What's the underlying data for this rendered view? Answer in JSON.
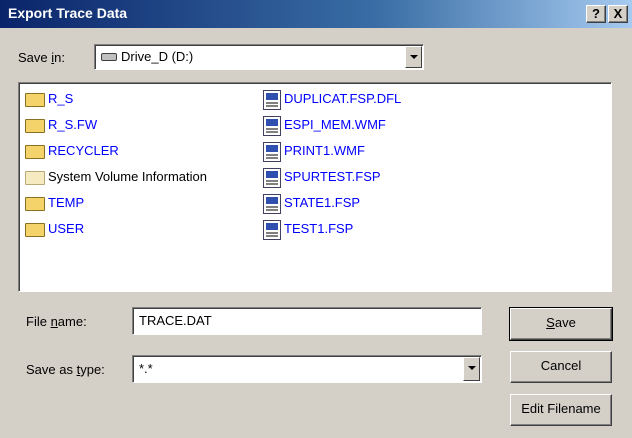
{
  "window": {
    "title": "Export Trace Data",
    "help_button": "?",
    "close_button": "X"
  },
  "save_in": {
    "label_pre": "Save ",
    "label_key": "i",
    "label_post": "n:",
    "value": "Drive_D (D:)",
    "icon": "drive-icon"
  },
  "files": {
    "column1": [
      {
        "name": "R_S",
        "icon": "folder-icon",
        "color": "#0000ff"
      },
      {
        "name": "R_S.FW",
        "icon": "folder-icon",
        "color": "#0000ff"
      },
      {
        "name": "RECYCLER",
        "icon": "folder-icon",
        "color": "#0000ff"
      },
      {
        "name": "System Volume Information",
        "icon": "folder-icon",
        "color": "#000000"
      },
      {
        "name": "TEMP",
        "icon": "folder-icon",
        "color": "#0000ff"
      },
      {
        "name": "USER",
        "icon": "folder-icon",
        "color": "#0000ff"
      }
    ],
    "column2": [
      {
        "name": "DUPLICAT.FSP.DFL",
        "icon": "file-icon"
      },
      {
        "name": "ESPI_MEM.WMF",
        "icon": "file-icon"
      },
      {
        "name": "PRINT1.WMF",
        "icon": "file-icon"
      },
      {
        "name": "SPURTEST.FSP",
        "icon": "file-icon"
      },
      {
        "name": "STATE1.FSP",
        "icon": "file-icon"
      },
      {
        "name": "TEST1.FSP",
        "icon": "file-icon"
      }
    ]
  },
  "file_name": {
    "label_pre": "File ",
    "label_key": "n",
    "label_post": "ame:",
    "value": "TRACE.DAT"
  },
  "save_as_type": {
    "label_pre": "Save as ",
    "label_key": "t",
    "label_post": "ype:",
    "value": "*.*"
  },
  "buttons": {
    "save_key": "S",
    "save_rest": "ave",
    "cancel": "Cancel",
    "edit_filename": "Edit Filename"
  },
  "colors": {
    "title_bar": "#0a246a",
    "dialog_bg": "#d4d0c8",
    "link_blue": "#0000ff"
  }
}
